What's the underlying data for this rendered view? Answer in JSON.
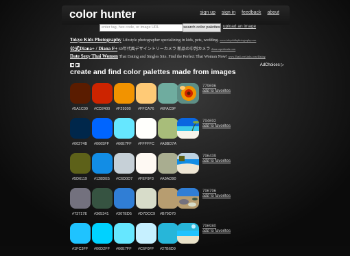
{
  "site": {
    "logo": "color hunter",
    "nav": [
      "sign up",
      "sign in",
      "feedback",
      "about"
    ],
    "search_placeholder": "enter tag, hex code, or image URL",
    "search_button": "search color palettes",
    "upload_link": "upload an image"
  },
  "ads": [
    {
      "title": "Tokyo Kids Photography",
      "text": "Lifestyle photographer specializing in kids, pets, wedding.",
      "url": "www.tokyokidsphotography.com"
    },
    {
      "title": "公式Diana+ / Diana F+",
      "text": "60年代風デザイントリーカメラ 新品の中判カメラ",
      "url": "diana.superheadz.com"
    },
    {
      "title": "Date Sexy Thai Women",
      "text": "Thai Dating and Singles Site. Find the Perfect Thai Woman Now!",
      "url": "www.ThaiLoveLinks.com/Dating"
    }
  ],
  "ad_choices": "AdChoices",
  "heading": "create and find color palettes made from images",
  "favorites_label": "add to favorites",
  "palettes": [
    {
      "id": "779696",
      "colors": [
        "#5A1C00",
        "#CD2400",
        "#F29300",
        "#FFCA76",
        "#6FAC9F"
      ],
      "thumb": "flower"
    },
    {
      "id": "794692",
      "colors": [
        "#00274B",
        "#0065FF",
        "#66E7FF",
        "#FFFFFC",
        "#A8BD7A"
      ],
      "thumb": "beach"
    },
    {
      "id": "796439",
      "colors": [
        "#5D6119",
        "#128DE5",
        "#C6D0D7",
        "#FEF9F3",
        "#A9AD90"
      ],
      "thumb": "coast"
    },
    {
      "id": "796796",
      "colors": [
        "#73717E",
        "#365341",
        "#307ED5",
        "#D7DCC9",
        "#B79D70"
      ],
      "thumb": "stones"
    },
    {
      "id": "796980",
      "colors": [
        "#1FC3FF",
        "#00D2FF",
        "#66E7FF",
        "#C6F0FF",
        "#27B6D9"
      ],
      "thumb": "sea"
    }
  ]
}
